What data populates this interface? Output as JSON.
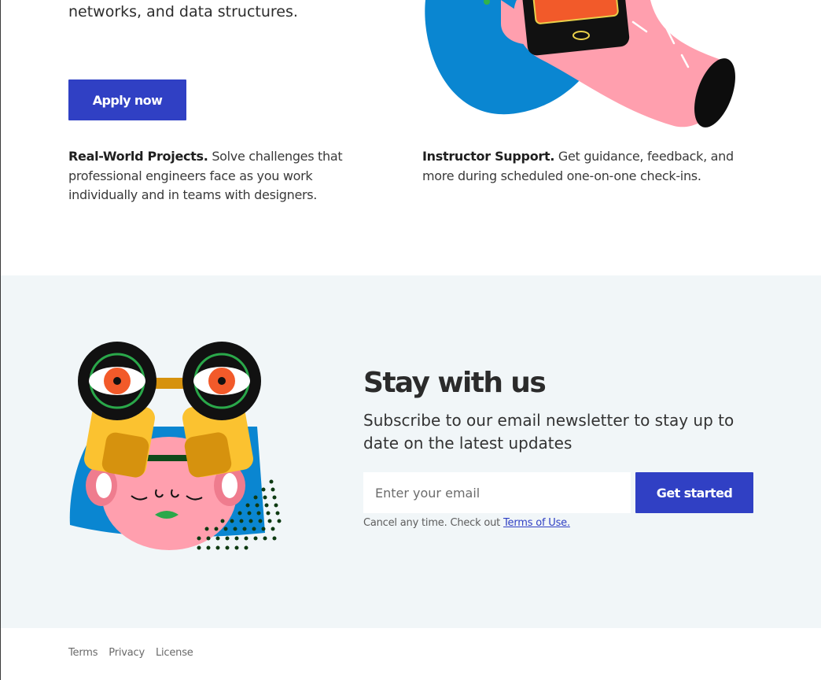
{
  "intro": {
    "text": "networks, and data structures."
  },
  "apply_button": "Apply now",
  "features": [
    {
      "title": "Real-World Projects.",
      "text": " Solve challenges that professional engineers face as you work individually and in teams with designers."
    },
    {
      "title": "Instructor Support.",
      "text": " Get guidance, feedback, and more during scheduled one-on-one check-ins."
    }
  ],
  "newsletter": {
    "title": "Stay with us",
    "description": "Subscribe to our email newsletter to stay up to date on the latest updates",
    "email_placeholder": "Enter your email",
    "submit_label": "Get started",
    "fine_print": "Cancel any time. Check out ",
    "terms_link": "Terms of Use."
  },
  "footer": {
    "links": [
      "Terms",
      "Privacy",
      "License"
    ]
  },
  "colors": {
    "accent": "#3040c4",
    "newsletter_bg": "#f1f6f8"
  }
}
